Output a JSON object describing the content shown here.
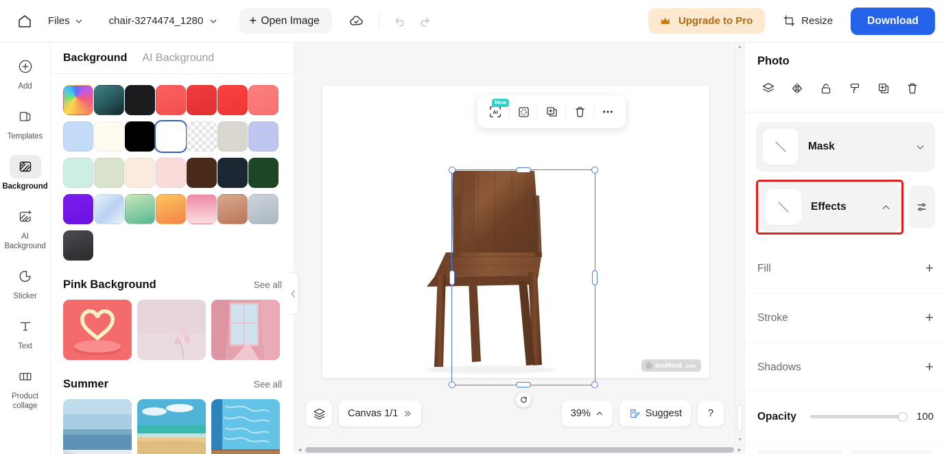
{
  "topbar": {
    "home_icon": "home-icon",
    "files_label": "Files",
    "filename": "chair-3274474_1280",
    "open_image_label": "Open Image",
    "cloud_icon": "cloud-saved-icon",
    "undo_icon": "undo-icon",
    "redo_icon": "redo-icon",
    "upgrade_label": "Upgrade to Pro",
    "crown_icon": "crown-icon",
    "resize_label": "Resize",
    "resize_icon": "crop-icon",
    "download_label": "Download",
    "accent_color": "#2563eb",
    "upgrade_bg": "#fde9cf",
    "upgrade_fg": "#b26a12"
  },
  "rail": {
    "items": [
      {
        "label": "Add",
        "icon": "plus-circle-icon",
        "active": false
      },
      {
        "label": "Templates",
        "icon": "templates-icon",
        "active": false
      },
      {
        "label": "Background",
        "icon": "background-icon",
        "active": true
      },
      {
        "label": "AI Background",
        "icon": "ai-background-icon",
        "active": false
      },
      {
        "label": "Sticker",
        "icon": "sticker-icon",
        "active": false
      },
      {
        "label": "Text",
        "icon": "text-icon",
        "active": false
      },
      {
        "label": "Product collage",
        "icon": "product-collage-icon",
        "active": false
      }
    ]
  },
  "panel": {
    "tabs": [
      {
        "label": "Background",
        "active": true
      },
      {
        "label": "AI Background",
        "active": false
      }
    ],
    "swatches": [
      {
        "name": "rainbow-gradient",
        "css": "conic-gradient(from 210deg at 42% 38%, #ffd84d, #6de07a, #3fc9f5, #5a6ef0, #c05ae8, #f25d7e, #f9a05a, #ffd84d)",
        "selected": false
      },
      {
        "name": "teal-dark-gradient",
        "css": "linear-gradient(145deg,#3e7f80,#2b5f62 45%,#14282c)",
        "selected": false
      },
      {
        "name": "near-black",
        "css": "#1c1c1e",
        "selected": false
      },
      {
        "name": "coral-red",
        "css": "linear-gradient(160deg,#fb6060,#f24f4f)",
        "selected": false
      },
      {
        "name": "strong-red",
        "css": "linear-gradient(160deg,#ef3b3b,#e23030)",
        "selected": false
      },
      {
        "name": "bright-red",
        "css": "linear-gradient(160deg,#fb4040,#f03535)",
        "selected": false
      },
      {
        "name": "salmon-pink",
        "css": "linear-gradient(160deg,#fb7e7e,#f87272)",
        "selected": false
      },
      {
        "name": "light-blue",
        "css": "#c3dbf7",
        "selected": false
      },
      {
        "name": "ivory",
        "css": "#fefbf0",
        "selected": false
      },
      {
        "name": "black",
        "css": "#000000",
        "selected": false
      },
      {
        "name": "white",
        "css": "#ffffff",
        "selected": true
      },
      {
        "name": "transparent",
        "css": "transparent",
        "selected": false
      },
      {
        "name": "warm-grey",
        "css": "#dad7d0",
        "selected": false
      },
      {
        "name": "periwinkle",
        "css": "#c0c5ef",
        "selected": false
      },
      {
        "name": "mint",
        "css": "#cdeee5",
        "selected": false
      },
      {
        "name": "sage",
        "css": "#d9e3cc",
        "selected": false
      },
      {
        "name": "cream-peach",
        "css": "#fbeade",
        "selected": false
      },
      {
        "name": "baby-pink",
        "css": "#fbdada",
        "selected": false
      },
      {
        "name": "dark-brown",
        "css": "#4a2a1b",
        "selected": false
      },
      {
        "name": "navy-charcoal",
        "css": "#1d2633",
        "selected": false
      },
      {
        "name": "forest-green",
        "css": "#1d4626",
        "selected": false
      },
      {
        "name": "violet",
        "css": "linear-gradient(160deg,#7b1ff0,#6a10e0)",
        "selected": false
      },
      {
        "name": "blue-white-gradient",
        "css": "linear-gradient(135deg,#e8f1fb,#b9d2f2 55%,#eef4fb)",
        "selected": false
      },
      {
        "name": "green-gradient",
        "css": "linear-gradient(160deg,#c8e6b8,#56b894)",
        "selected": false
      },
      {
        "name": "orange-gradient",
        "css": "linear-gradient(160deg,#fcc659,#f4834e)",
        "selected": false
      },
      {
        "name": "pink-gradient",
        "css": "linear-gradient(180deg,#ef8aa8,#fbdedc)",
        "selected": false
      },
      {
        "name": "tan-gradient",
        "css": "linear-gradient(160deg,#d9a88d,#b9765a)",
        "selected": false
      },
      {
        "name": "silver-blue",
        "css": "linear-gradient(160deg,#cdd5dd,#aab6c2)",
        "selected": false
      },
      {
        "name": "charcoal-gradient",
        "css": "linear-gradient(160deg,#4c4c50,#2a2a2d)",
        "selected": false
      }
    ],
    "sections": [
      {
        "title": "Pink Background",
        "see_all": "See all",
        "thumbs": [
          {
            "name": "pink-heart-lights"
          },
          {
            "name": "pink-flower-minimal"
          },
          {
            "name": "pink-curtain-window"
          }
        ]
      },
      {
        "title": "Summer",
        "see_all": "See all",
        "thumbs": [
          {
            "name": "calm-sea-horizon"
          },
          {
            "name": "beach-sand-waves"
          },
          {
            "name": "pool-water-deck"
          }
        ]
      }
    ],
    "collapse_icon": "chevron-left-icon"
  },
  "canvas": {
    "float_toolbar": [
      {
        "name": "ai-tool",
        "label": "AI",
        "badge": "New"
      },
      {
        "name": "cutout-tool",
        "label": "",
        "badge": ""
      },
      {
        "name": "duplicate-tool",
        "label": "",
        "badge": ""
      },
      {
        "name": "delete-tool",
        "label": "",
        "badge": ""
      },
      {
        "name": "more-tool",
        "label": "",
        "badge": ""
      }
    ],
    "selection_color": "#4a7fe0",
    "watermark": {
      "text": "insMind",
      "suffix": ".com"
    },
    "image_alt": "wooden chair"
  },
  "bottombar": {
    "layers_icon": "layers-icon",
    "canvas_label": "Canvas 1/1",
    "canvas_expand_icon": "chevrons-right-icon",
    "zoom_label": "39%",
    "zoom_caret": "chevron-up-icon",
    "suggest_label": "Suggest",
    "suggest_icon": "suggest-note-icon",
    "help_label": "?"
  },
  "rightpanel": {
    "title": "Photo",
    "tools": [
      {
        "name": "layers-icon"
      },
      {
        "name": "flip-icon"
      },
      {
        "name": "unlock-icon"
      },
      {
        "name": "paint-format-icon"
      },
      {
        "name": "duplicate-icon"
      },
      {
        "name": "trash-icon"
      }
    ],
    "mask": {
      "label": "Mask",
      "caret": "chevron-down-icon"
    },
    "effects": {
      "label": "Effects",
      "caret": "chevron-up-icon",
      "highlight_color": "#e02020",
      "adjust_icon": "sliders-icon"
    },
    "props": [
      {
        "label": "Fill",
        "action": "+",
        "bold": false
      },
      {
        "label": "Stroke",
        "action": "+",
        "bold": false
      },
      {
        "label": "Shadows",
        "action": "+",
        "bold": false
      }
    ],
    "opacity": {
      "label": "Opacity",
      "value": "100",
      "percent": 100
    }
  }
}
